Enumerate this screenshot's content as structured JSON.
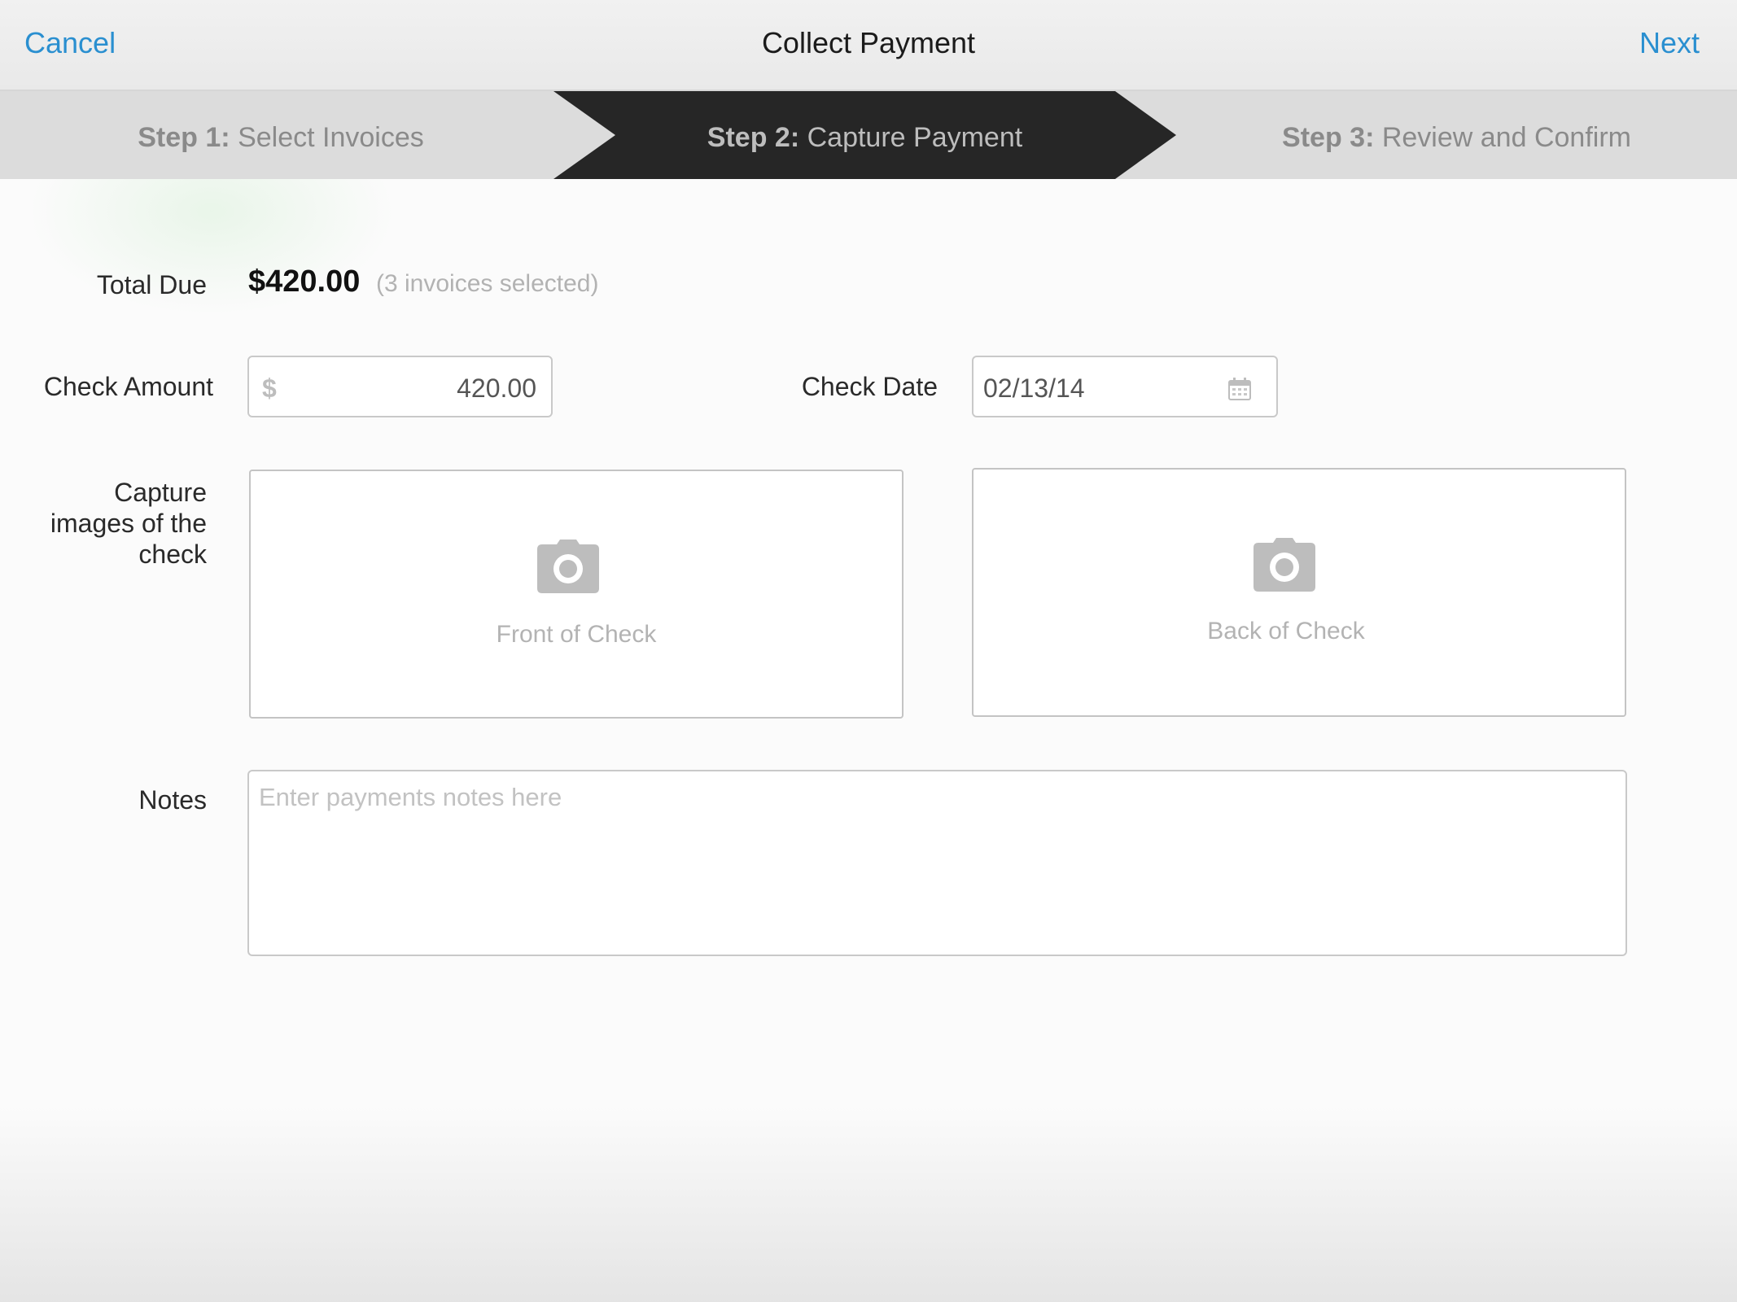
{
  "nav": {
    "cancel_label": "Cancel",
    "title": "Collect Payment",
    "next_label": "Next",
    "link_color": "#2a8fd0"
  },
  "steps": [
    {
      "prefix": "Step 1:",
      "label": "Select Invoices",
      "active": false
    },
    {
      "prefix": "Step 2:",
      "label": "Capture Payment",
      "active": true
    },
    {
      "prefix": "Step 3:",
      "label": "Review and Confirm",
      "active": false
    }
  ],
  "form": {
    "total_due_label": "Total Due",
    "total_due_amount": "$420.00",
    "total_due_note": "(3 invoices selected)",
    "check_amount_label": "Check Amount",
    "currency_symbol": "$",
    "check_amount_value": "420.00",
    "check_date_label": "Check Date",
    "check_date_value": "02/13/14",
    "capture_label_line1": "Capture",
    "capture_label_line2": "images of the",
    "capture_label_line3": "check",
    "front_label": "Front of Check",
    "back_label": "Back of Check",
    "notes_label": "Notes",
    "notes_placeholder": "Enter payments notes here",
    "notes_value": ""
  },
  "icons": {
    "calendar": "calendar-icon",
    "camera": "camera-icon"
  }
}
